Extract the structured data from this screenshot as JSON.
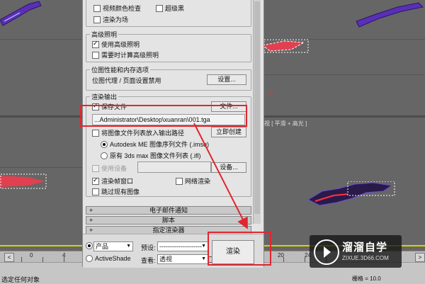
{
  "viewports": {
    "bottom_right_label": "透视 [ 平滑 + 高光 ]"
  },
  "timeline": {
    "ticks": [
      "0",
      "4",
      "20",
      "24"
    ]
  },
  "status": {
    "left_text": "选定任何对象",
    "grid_label": "栅格 =",
    "grid_value": "10.0"
  },
  "render_dialog": {
    "options": {
      "video_color_check": "视频颜色检查",
      "super_black": "超级黑",
      "render_to_fields": "渲染为场"
    },
    "advanced_lighting": {
      "title": "高级照明",
      "use_advanced": "使用高级照明",
      "compute_when_required": "需要时计算高级照明"
    },
    "bitmap_performance": {
      "title": "位图性能和内存选项",
      "status_text": "位图代理 / 页面设置禁用",
      "settings_button": "设置..."
    },
    "render_output": {
      "title": "渲染输出",
      "save_file": "保存文件",
      "files_button": "文件...",
      "file_path": "...Administrator\\Desktop\\xuanran\\001.tga",
      "put_image_file_list": "将图像文件列表放入输出路径",
      "create_now_button": "立即创建",
      "autodesk_me_option": "Autodesk ME 图像序列文件 (.imsq)",
      "legacy_option": "原有 3ds max 图像文件列表 (.ifl)",
      "use_device": "使用设备",
      "devices_button": "设备...",
      "rendered_frame_window": "渲染帧窗口",
      "net_render": "网络渲染",
      "skip_existing": "跳过现有图像"
    },
    "rollouts": {
      "email": "电子邮件通知",
      "scripts": "脚本",
      "assign_renderer": "指定渲染器"
    },
    "bottom": {
      "production": "产品",
      "activeshade": "ActiveShade",
      "preset_label": "预设:",
      "preset_value": "--------------------",
      "view_label": "查看:",
      "view_value": "透视",
      "render_button": "渲染"
    }
  },
  "watermark": {
    "title": "溜溜自学",
    "subtitle": "ZIXUE.3D66.COM"
  },
  "colors": {
    "annotation_red": "#e0262f",
    "timeline_yellow": "#d8d200"
  }
}
